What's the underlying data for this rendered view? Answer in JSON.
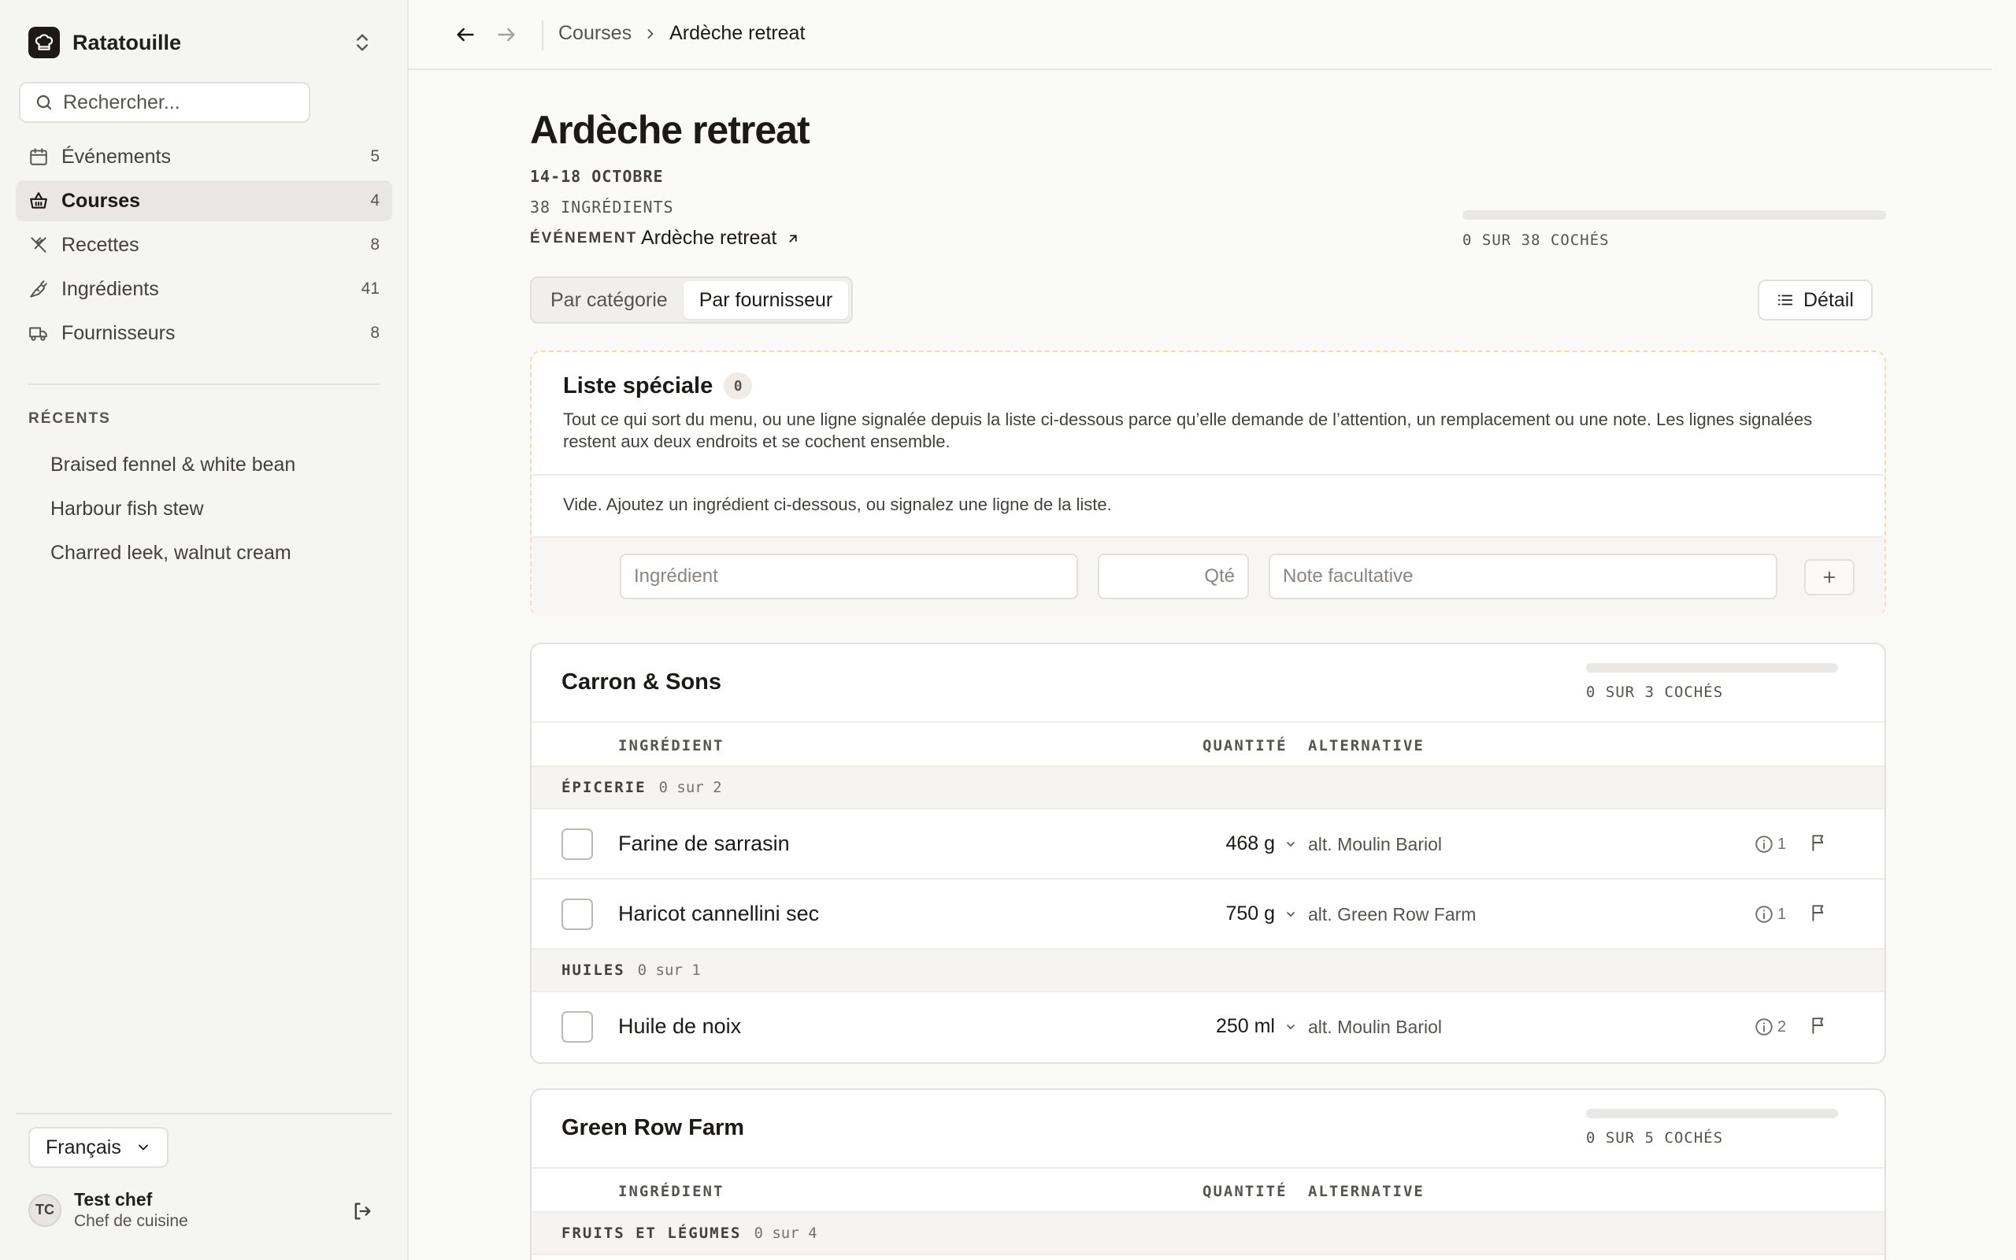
{
  "app": {
    "name": "Ratatouille"
  },
  "search": {
    "placeholder": "Rechercher..."
  },
  "nav": [
    {
      "label": "Événements",
      "count": "5",
      "icon": "calendar-icon"
    },
    {
      "label": "Courses",
      "count": "4",
      "icon": "basket-icon",
      "active": true
    },
    {
      "label": "Recettes",
      "count": "8",
      "icon": "utensils-icon"
    },
    {
      "label": "Ingrédients",
      "count": "41",
      "icon": "carrot-icon"
    },
    {
      "label": "Fournisseurs",
      "count": "8",
      "icon": "truck-icon"
    }
  ],
  "recents": {
    "title": "RÉCENTS",
    "items": [
      "Braised fennel & white bean",
      "Harbour fish stew",
      "Charred leek, walnut cream"
    ]
  },
  "language": {
    "selected": "Français"
  },
  "user": {
    "initials": "TC",
    "name": "Test chef",
    "role": "Chef de cuisine"
  },
  "breadcrumb": {
    "parent": "Courses",
    "current": "Ardèche retreat"
  },
  "page": {
    "title": "Ardèche retreat",
    "dates": "14-18 OCTOBRE",
    "ingredient_count": "38 INGRÉDIENTS",
    "event_label": "ÉVÉNEMENT",
    "event_name": "Ardèche retreat",
    "progress_text": "0 SUR 38 COCHÉS",
    "progress": 0
  },
  "view_toggle": {
    "by_category": "Par catégorie",
    "by_supplier": "Par fournisseur",
    "active": "by_supplier"
  },
  "detail_button": "Détail",
  "special_list": {
    "title": "Liste spéciale",
    "count": "0",
    "description": "Tout ce qui sort du menu, ou une ligne signalée depuis la liste ci-dessous parce qu’elle demande de l’attention, un remplacement ou une note. Les lignes signalées restent aux deux endroits et se cochent ensemble.",
    "empty": "Vide. Ajoutez un ingrédient ci-dessous, ou signalez une ligne de la liste.",
    "ingredient_placeholder": "Ingrédient",
    "qty_placeholder": "Qté",
    "note_placeholder": "Note facultative",
    "add_label": "+"
  },
  "columns": {
    "ingredient": "INGRÉDIENT",
    "quantity": "QUANTITÉ",
    "alternative": "ALTERNATIVE"
  },
  "suppliers": [
    {
      "name": "Carron & Sons",
      "progress_text": "0 SUR 3 COCHÉS",
      "progress": 0,
      "categories": [
        {
          "name": "ÉPICERIE",
          "count": "0 sur 2",
          "items": [
            {
              "name": "Farine de sarrasin",
              "qty": "468 g",
              "alt": "alt. Moulin Bariol",
              "info": "1"
            },
            {
              "name": "Haricot cannellini sec",
              "qty": "750 g",
              "alt": "alt. Green Row Farm",
              "info": "1"
            }
          ]
        },
        {
          "name": "HUILES",
          "count": "0 sur 1",
          "items": [
            {
              "name": "Huile de noix",
              "qty": "250 ml",
              "alt": "alt. Moulin Bariol",
              "info": "2"
            }
          ]
        }
      ]
    },
    {
      "name": "Green Row Farm",
      "progress_text": "0 SUR 5 COCHÉS",
      "progress": 0,
      "categories": [
        {
          "name": "FRUITS ET LÉGUMES",
          "count": "0 sur 4",
          "items": []
        }
      ]
    }
  ]
}
